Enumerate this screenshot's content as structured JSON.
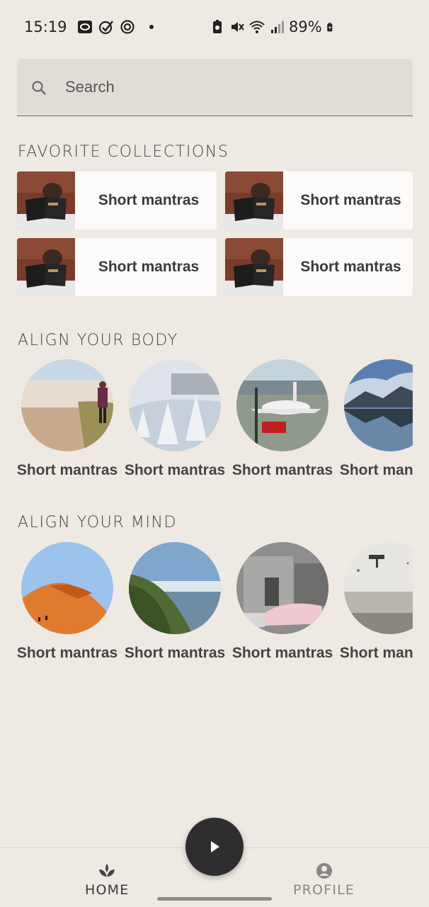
{
  "status": {
    "time": "15:19",
    "battery": "89%"
  },
  "search": {
    "placeholder": "Search"
  },
  "favorites": {
    "title": "FAVORITE COLLECTIONS",
    "items": [
      {
        "label": "Short mantras"
      },
      {
        "label": "Short mantras"
      },
      {
        "label": "Short mantras"
      },
      {
        "label": "Short mantras"
      }
    ]
  },
  "body_section": {
    "title": "ALIGN YOUR BODY",
    "items": [
      {
        "label": "Short mantras",
        "image": "beach-walk"
      },
      {
        "label": "Short mantras",
        "image": "snowy-field"
      },
      {
        "label": "Short mantras",
        "image": "airplane"
      },
      {
        "label": "Short mantras",
        "image": "mountain-lake"
      }
    ]
  },
  "mind_section": {
    "title": "ALIGN YOUR MIND",
    "items": [
      {
        "label": "Short mantras",
        "image": "desert-dune"
      },
      {
        "label": "Short mantras",
        "image": "coastal-cliffs"
      },
      {
        "label": "Short mantras",
        "image": "street-building"
      },
      {
        "label": "Short mantras",
        "image": "white-wall"
      }
    ]
  },
  "nav": {
    "home_label": "HOME",
    "profile_label": "PROFILE"
  },
  "colors": {
    "background": "#efe9e3",
    "card": "#fcfbf9",
    "fab": "#2e2e2e"
  }
}
